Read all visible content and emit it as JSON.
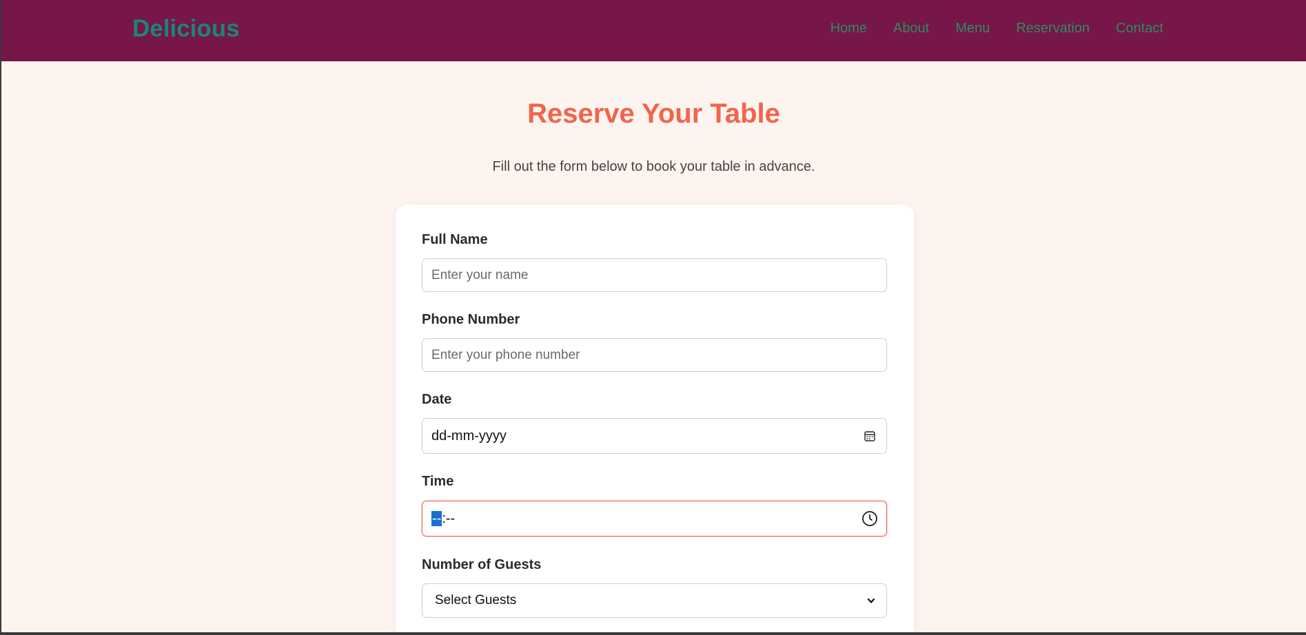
{
  "navbar": {
    "brand": "Delicious",
    "links": [
      "Home",
      "About",
      "Menu",
      "Reservation",
      "Contact"
    ],
    "bg_color": "#761649",
    "brand_color": "#1c8577",
    "link_color": "#2f8c58"
  },
  "hero": {
    "title": "Reserve Your Table",
    "subtitle": "Fill out the form below to book your table in advance.",
    "title_color": "#f2644b"
  },
  "form": {
    "full_name": {
      "label": "Full Name",
      "placeholder": "Enter your name",
      "value": ""
    },
    "phone": {
      "label": "Phone Number",
      "placeholder": "Enter your phone number",
      "value": ""
    },
    "date": {
      "label": "Date",
      "display": "dd-mm-yyyy",
      "icon": "calendar-icon"
    },
    "time": {
      "label": "Time",
      "hour_segment": "--",
      "separator": ":",
      "minute_segment": "--",
      "icon": "clock-icon",
      "focused": true
    },
    "guests": {
      "label": "Number of Guests",
      "selected": "Select Guests",
      "icon": "chevron-down-icon"
    }
  }
}
